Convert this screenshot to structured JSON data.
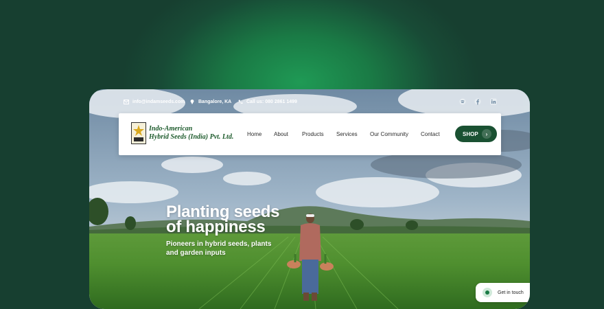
{
  "topbar": {
    "email": "info@indamseeds.com",
    "location": "Bangalore, KA",
    "phone": "Call us: 080 2861 1499",
    "social": [
      "spotify-icon",
      "facebook-icon",
      "linkedin-icon"
    ]
  },
  "brand": {
    "line1": "Indo-American",
    "line2": "Hybrid Seeds (India) Pvt. Ltd."
  },
  "menu": [
    "Home",
    "About",
    "Products",
    "Services",
    "Our Community",
    "Contact"
  ],
  "shop": {
    "label": "SHOP"
  },
  "hero": {
    "title_line1": "Planting seeds",
    "title_line2": "of happiness",
    "subtitle_line1": "Pioneers in hybrid seeds, plants",
    "subtitle_line2": "and garden inputs"
  },
  "contact_widget": {
    "label": "Get in touch"
  },
  "colors": {
    "brand_green": "#1a5132",
    "accent_green": "#1a7a45",
    "field_green": "#3f8a2e"
  }
}
